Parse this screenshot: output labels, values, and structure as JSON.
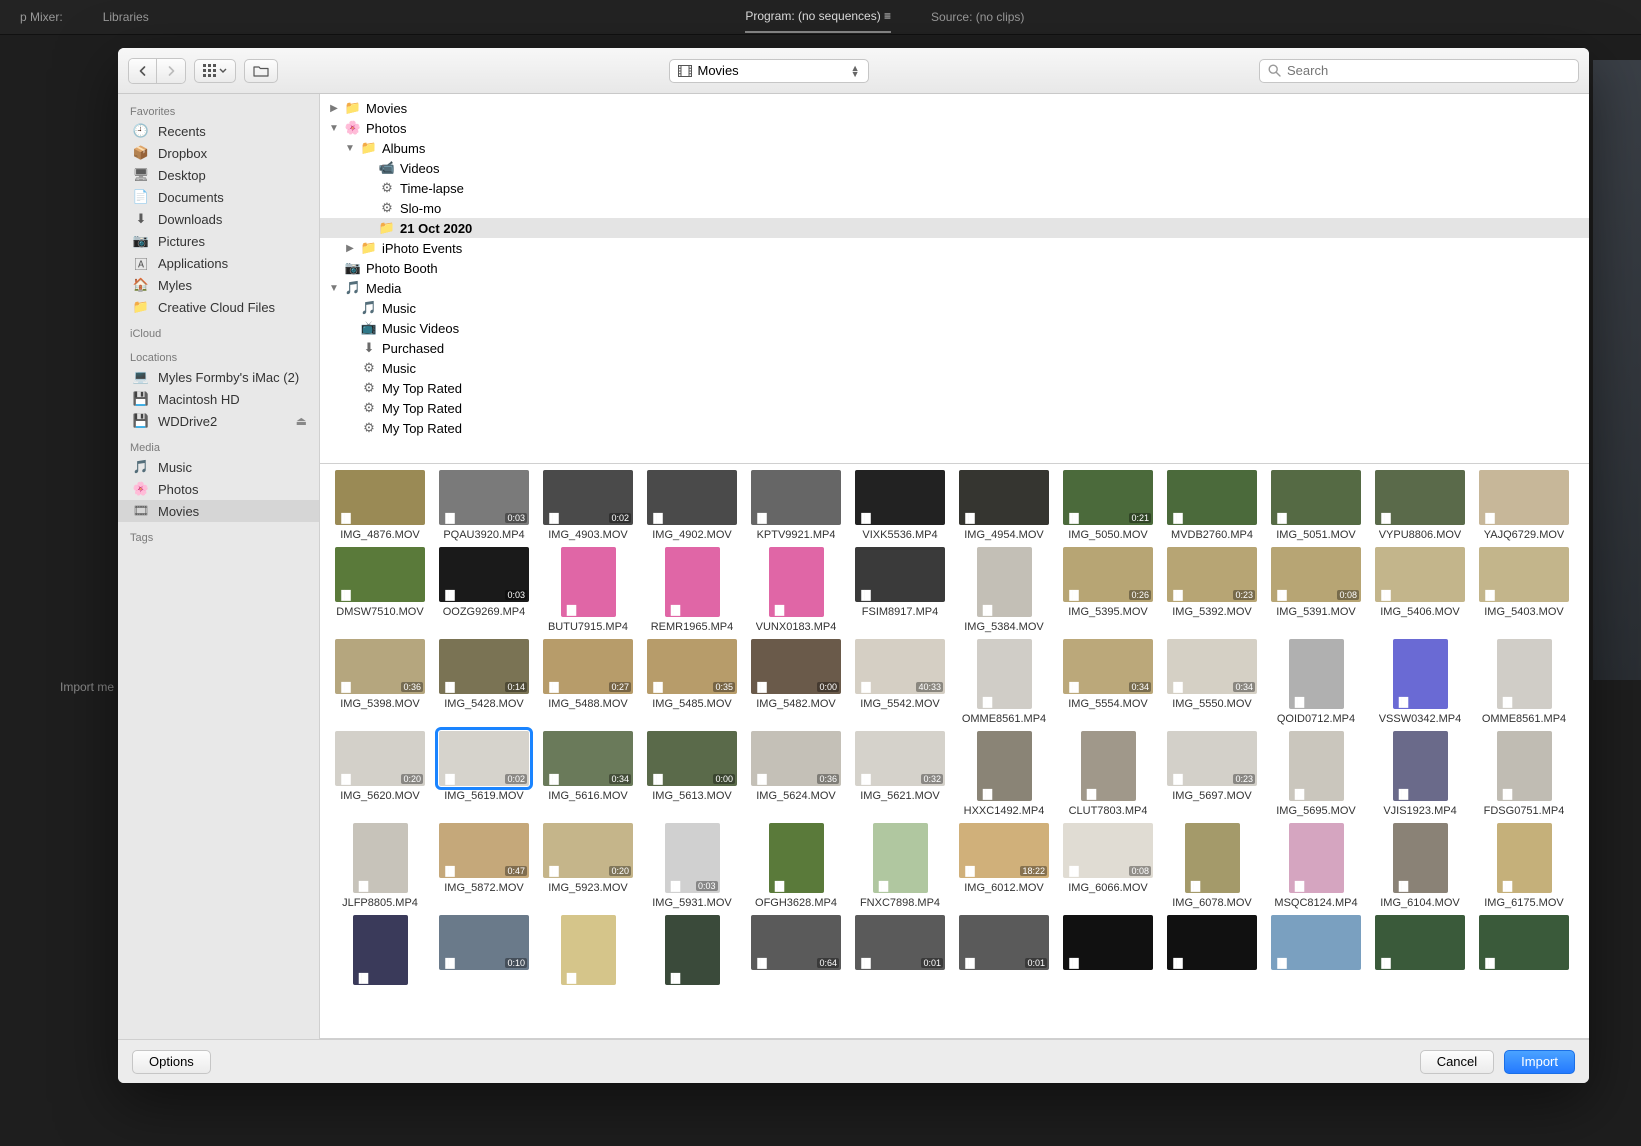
{
  "background": {
    "tab_mixer": "p Mixer:",
    "tab_libraries": "Libraries",
    "tab_program": "Program: (no sequences) ≡",
    "tab_source": "Source: (no clips)",
    "import_label": "Import me"
  },
  "toolbar": {
    "path_label": "Movies",
    "search_placeholder": "Search"
  },
  "sidebar": {
    "sections": [
      {
        "title": "Favorites",
        "items": [
          {
            "icon": "🕘",
            "label": "Recents"
          },
          {
            "icon": "📦",
            "label": "Dropbox"
          },
          {
            "icon": "🖥",
            "label": "Desktop"
          },
          {
            "icon": "📄",
            "label": "Documents"
          },
          {
            "icon": "⬇",
            "label": "Downloads"
          },
          {
            "icon": "📷",
            "label": "Pictures"
          },
          {
            "icon": "🄰",
            "label": "Applications"
          },
          {
            "icon": "🏠",
            "label": "Myles"
          },
          {
            "icon": "📁",
            "label": "Creative Cloud Files"
          }
        ]
      },
      {
        "title": "iCloud",
        "items": []
      },
      {
        "title": "Locations",
        "items": [
          {
            "icon": "💻",
            "label": "Myles Formby's iMac (2)"
          },
          {
            "icon": "💾",
            "label": "Macintosh HD"
          },
          {
            "icon": "💾",
            "label": "WDDrive2",
            "eject": true
          }
        ]
      },
      {
        "title": "Media",
        "items": [
          {
            "icon": "🎵",
            "label": "Music"
          },
          {
            "icon": "🌸",
            "label": "Photos"
          },
          {
            "icon": "🎞",
            "label": "Movies",
            "selected": true
          }
        ]
      },
      {
        "title": "Tags",
        "items": []
      }
    ]
  },
  "tree": [
    {
      "indent": 0,
      "disc": "▶",
      "icon": "📁",
      "label": "Movies"
    },
    {
      "indent": 0,
      "disc": "▼",
      "icon": "🌸",
      "label": "Photos"
    },
    {
      "indent": 1,
      "disc": "▼",
      "icon": "📁",
      "label": "Albums"
    },
    {
      "indent": 2,
      "disc": "",
      "icon": "📹",
      "label": "Videos"
    },
    {
      "indent": 2,
      "disc": "",
      "icon": "⚙",
      "label": "Time-lapse"
    },
    {
      "indent": 2,
      "disc": "",
      "icon": "⚙",
      "label": "Slo-mo"
    },
    {
      "indent": 2,
      "disc": "",
      "icon": "📁",
      "label": "21 Oct 2020",
      "selected": true
    },
    {
      "indent": 1,
      "disc": "▶",
      "icon": "📁",
      "label": "iPhoto Events"
    },
    {
      "indent": 0,
      "disc": "",
      "icon": "📷",
      "label": "Photo Booth"
    },
    {
      "indent": 0,
      "disc": "▼",
      "icon": "🎵",
      "label": "Media"
    },
    {
      "indent": 1,
      "disc": "",
      "icon": "🎵",
      "label": "Music"
    },
    {
      "indent": 1,
      "disc": "",
      "icon": "📺",
      "label": "Music Videos"
    },
    {
      "indent": 1,
      "disc": "",
      "icon": "⬇",
      "label": "Purchased"
    },
    {
      "indent": 1,
      "disc": "",
      "icon": "⚙",
      "label": "Music"
    },
    {
      "indent": 1,
      "disc": "",
      "icon": "⚙",
      "label": "My Top Rated"
    },
    {
      "indent": 1,
      "disc": "",
      "icon": "⚙",
      "label": "My Top Rated"
    },
    {
      "indent": 1,
      "disc": "",
      "icon": "⚙",
      "label": "My Top Rated"
    }
  ],
  "files": [
    {
      "name": "IMG_4876.MOV",
      "dur": "",
      "c": "#9a8a55"
    },
    {
      "name": "PQAU3920.MP4",
      "dur": "0:03",
      "c": "#7a7a7a"
    },
    {
      "name": "IMG_4903.MOV",
      "dur": "0:02",
      "c": "#4a4a4a"
    },
    {
      "name": "IMG_4902.MOV",
      "dur": "",
      "c": "#4a4a4a"
    },
    {
      "name": "KPTV9921.MP4",
      "dur": "",
      "c": "#666"
    },
    {
      "name": "VIXK5536.MP4",
      "dur": "",
      "c": "#222"
    },
    {
      "name": "IMG_4954.MOV",
      "dur": "",
      "c": "#353530"
    },
    {
      "name": "IMG_5050.MOV",
      "dur": "0:21",
      "c": "#4b6a3b"
    },
    {
      "name": "MVDB2760.MP4",
      "dur": "",
      "c": "#4b6a3b"
    },
    {
      "name": "IMG_5051.MOV",
      "dur": "",
      "c": "#556a44"
    },
    {
      "name": "VYPU8806.MOV",
      "dur": "",
      "c": "#5a6a4a"
    },
    {
      "name": "YAJQ6729.MOV",
      "dur": "",
      "c": "#c7b799"
    },
    {
      "name": "DMSW7510.MOV",
      "dur": "",
      "c": "#5a7a3a"
    },
    {
      "name": "OOZG9269.MP4",
      "dur": "0:03",
      "c": "#1a1a1a"
    },
    {
      "name": "BUTU7915.MP4",
      "dur": "",
      "c": "#e066a6",
      "port": true
    },
    {
      "name": "REMR1965.MP4",
      "dur": "",
      "c": "#e066a6",
      "port": true
    },
    {
      "name": "VUNX0183.MP4",
      "dur": "",
      "c": "#e066a6",
      "port": true
    },
    {
      "name": "FSIM8917.MP4",
      "dur": "",
      "c": "#3a3a3a"
    },
    {
      "name": "IMG_5384.MOV",
      "dur": "",
      "c": "#c3bfb6",
      "port": true
    },
    {
      "name": "IMG_5395.MOV",
      "dur": "0:26",
      "c": "#b7a574"
    },
    {
      "name": "IMG_5392.MOV",
      "dur": "0:23",
      "c": "#b7a574"
    },
    {
      "name": "IMG_5391.MOV",
      "dur": "0:08",
      "c": "#b7a574"
    },
    {
      "name": "IMG_5406.MOV",
      "dur": "",
      "c": "#c3b58b"
    },
    {
      "name": "IMG_5403.MOV",
      "dur": "",
      "c": "#c3b58b"
    },
    {
      "name": "IMG_5398.MOV",
      "dur": "0:36",
      "c": "#b5a67e"
    },
    {
      "name": "IMG_5428.MOV",
      "dur": "0:14",
      "c": "#7a7354"
    },
    {
      "name": "IMG_5488.MOV",
      "dur": "0:27",
      "c": "#b79c6a"
    },
    {
      "name": "IMG_5485.MOV",
      "dur": "0:35",
      "c": "#b79c6a"
    },
    {
      "name": "IMG_5482.MOV",
      "dur": "0:00",
      "c": "#6a5a4a"
    },
    {
      "name": "IMG_5542.MOV",
      "dur": "40:33",
      "c": "#d5cfc4"
    },
    {
      "name": "OMME8561.MP4",
      "dur": "",
      "c": "#d0cdc7",
      "port": true
    },
    {
      "name": "IMG_5554.MOV",
      "dur": "0:34",
      "c": "#bba87a"
    },
    {
      "name": "IMG_5550.MOV",
      "dur": "0:34",
      "c": "#d5d0c5"
    },
    {
      "name": "QOID0712.MP4",
      "dur": "",
      "c": "#b0b0b0",
      "port": true
    },
    {
      "name": "VSSW0342.MP4",
      "dur": "",
      "c": "#6a6ad4",
      "port": true
    },
    {
      "name": "OMME8561.MP4",
      "dur": "",
      "c": "#d0cdc7",
      "port": true
    },
    {
      "name": "IMG_5620.MOV",
      "dur": "0:20",
      "c": "#d3d0c9"
    },
    {
      "name": "IMG_5619.MOV",
      "dur": "0:02",
      "c": "#d6d3cc",
      "selected": true
    },
    {
      "name": "IMG_5616.MOV",
      "dur": "0:34",
      "c": "#6a7a5a"
    },
    {
      "name": "IMG_5613.MOV",
      "dur": "0:00",
      "c": "#5a6a4a"
    },
    {
      "name": "IMG_5624.MOV",
      "dur": "0:36",
      "c": "#c4c0b7"
    },
    {
      "name": "IMG_5621.MOV",
      "dur": "0:32",
      "c": "#d5d2cb"
    },
    {
      "name": "HXXC1492.MP4",
      "dur": "",
      "c": "#8a8476",
      "port": true
    },
    {
      "name": "CLUT7803.MP4",
      "dur": "",
      "c": "#a0988a",
      "port": true
    },
    {
      "name": "IMG_5697.MOV",
      "dur": "0:23",
      "c": "#d3d0c9"
    },
    {
      "name": "IMG_5695.MOV",
      "dur": "",
      "c": "#cac6bd",
      "port": true
    },
    {
      "name": "VJIS1923.MP4",
      "dur": "",
      "c": "#6a6a8a",
      "port": true
    },
    {
      "name": "FDSG0751.MP4",
      "dur": "",
      "c": "#c0bcb3",
      "port": true
    },
    {
      "name": "JLFP8805.MP4",
      "dur": "",
      "c": "#c7c3ba",
      "port": true
    },
    {
      "name": "IMG_5872.MOV",
      "dur": "0:47",
      "c": "#c5a87a"
    },
    {
      "name": "IMG_5923.MOV",
      "dur": "0:20",
      "c": "#c5b58a"
    },
    {
      "name": "IMG_5931.MOV",
      "dur": "0:03",
      "c": "#d0d0d0",
      "port": true
    },
    {
      "name": "OFGH3628.MP4",
      "dur": "",
      "c": "#5a7a3a",
      "port": true
    },
    {
      "name": "FNXC7898.MP4",
      "dur": "",
      "c": "#b0c7a0",
      "port": true
    },
    {
      "name": "IMG_6012.MOV",
      "dur": "18:22",
      "c": "#d0b07a"
    },
    {
      "name": "IMG_6066.MOV",
      "dur": "0:08",
      "c": "#e0dcd3"
    },
    {
      "name": "IMG_6078.MOV",
      "dur": "",
      "c": "#a49a6a",
      "port": true
    },
    {
      "name": "MSQC8124.MP4",
      "dur": "",
      "c": "#d5a5c0",
      "port": true
    },
    {
      "name": "IMG_6104.MOV",
      "dur": "",
      "c": "#8a8276",
      "port": true
    },
    {
      "name": "IMG_6175.MOV",
      "dur": "",
      "c": "#c5b07a",
      "port": true
    },
    {
      "name": "",
      "dur": "",
      "c": "#3a3a5a",
      "port": true
    },
    {
      "name": "",
      "dur": "0:10",
      "c": "#6a7a8a"
    },
    {
      "name": "",
      "dur": "",
      "c": "#d5c58a",
      "port": true
    },
    {
      "name": "",
      "dur": "",
      "c": "#3a4a3a",
      "port": true
    },
    {
      "name": "",
      "dur": "0:64",
      "c": "#5a5a5a"
    },
    {
      "name": "",
      "dur": "0:01",
      "c": "#5a5a5a"
    },
    {
      "name": "",
      "dur": "0:01",
      "c": "#5a5a5a"
    },
    {
      "name": "",
      "dur": "",
      "c": "#111"
    },
    {
      "name": "",
      "dur": "",
      "c": "#111"
    },
    {
      "name": "",
      "dur": "",
      "c": "#7aa0c0"
    },
    {
      "name": "",
      "dur": "",
      "c": "#3a5a3a"
    },
    {
      "name": "",
      "dur": "",
      "c": "#3a5a3a"
    }
  ],
  "footer": {
    "options": "Options",
    "cancel": "Cancel",
    "import": "Import"
  }
}
